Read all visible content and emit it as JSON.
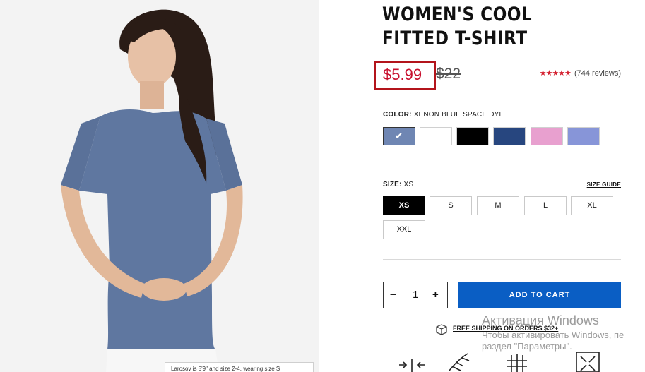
{
  "product": {
    "title": "WOMEN'S COOL FITTED T-SHIRT",
    "sale_price": "$5.99",
    "original_price": "$22",
    "stars": "★★★★★",
    "reviews": "(744 reviews)",
    "image_caption": "Larosov is 5'9\" and size 2-4, wearing size S"
  },
  "color": {
    "label": "COLOR:",
    "value": "XENON BLUE SPACE DYE",
    "swatches": [
      {
        "name": "xenon-blue-space-dye",
        "hex": "#6f86b3"
      },
      {
        "name": "white",
        "hex": "#ffffff"
      },
      {
        "name": "black",
        "hex": "#000000"
      },
      {
        "name": "navy",
        "hex": "#27467f"
      },
      {
        "name": "pink",
        "hex": "#e8a0cf"
      },
      {
        "name": "periwinkle",
        "hex": "#8795d8"
      }
    ],
    "check": "✔"
  },
  "size": {
    "label": "SIZE:",
    "value": "XS",
    "guide": "SIZE GUIDE",
    "options": [
      "XS",
      "S",
      "M",
      "L",
      "XL",
      "XXL"
    ]
  },
  "cart": {
    "minus": "−",
    "quantity": "1",
    "plus": "+",
    "button": "ADD TO CART"
  },
  "shipping": {
    "text": "FREE SHIPPING ON ORDERS $32+"
  },
  "watermark": {
    "line1": "Активация Windows",
    "line2": "Чтобы активировать Windows, пе",
    "line3": "раздел \"Параметры\"."
  },
  "colors": {
    "sale": "#c8102e",
    "highlight_box": "#b3141b",
    "cart_button": "#0a5ec4",
    "shirt": "#5f77a0"
  }
}
